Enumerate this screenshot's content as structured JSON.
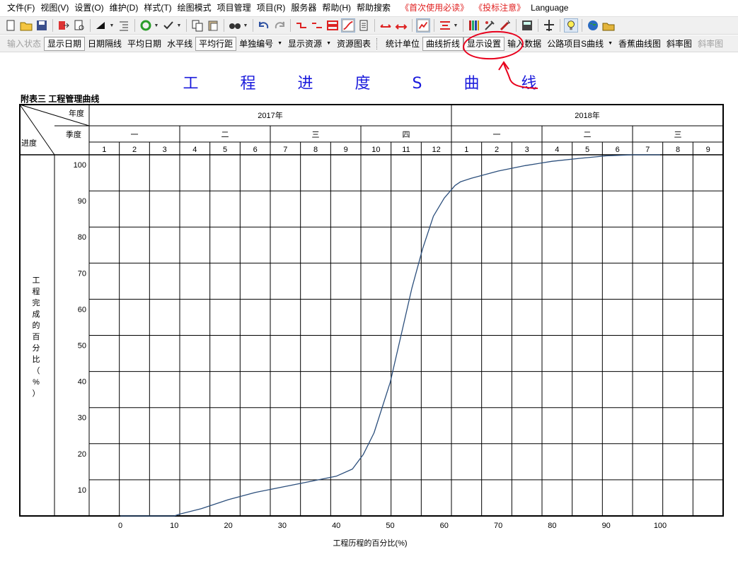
{
  "menubar": {
    "items": [
      "文件(F)",
      "视图(V)",
      "设置(O)",
      "维护(D)",
      "样式(T)",
      "绘图模式",
      "项目管理",
      "项目(R)",
      "服务器",
      "帮助(H)",
      "帮助搜索",
      "《首次使用必读》",
      "《投标注意》",
      "Language"
    ],
    "highlight_color": "#e02020"
  },
  "icon_toolbar": {
    "icons": [
      "new-icon",
      "open-icon",
      "save-icon",
      "export-icon",
      "print-preview-icon",
      "fill-icon",
      "indent-icon",
      "refresh-icon",
      "check-icon",
      "copy-icon",
      "paste-icon",
      "find-icon",
      "undo-icon",
      "redo-icon",
      "link-icon",
      "unlink-icon",
      "split-icon",
      "curve-icon",
      "resource-icon",
      "arrow-left-right-icon",
      "arrow-expand-icon",
      "chart-icon",
      "align-icon",
      "books-icon",
      "tools-icon",
      "magic-icon",
      "calculator-icon",
      "plane-icon",
      "bulb-icon",
      "globe-icon",
      "folder-icon"
    ]
  },
  "text_toolbar": {
    "buttons": [
      "输入状态",
      "显示日期",
      "日期隔线",
      "平均日期",
      "水平线",
      "平均行距",
      "单独编号",
      "显示资源",
      "资源图表",
      "统计单位",
      "曲线折线",
      "显示设置",
      "输入数据",
      "公路项目S曲线",
      "香蕉曲线图",
      "斜率图",
      "斜率图"
    ]
  },
  "document": {
    "title": "工 程 进 度 S 曲 线",
    "subtitle": "附表三    工程管理曲线",
    "title_color": "#1a1adc",
    "curve_color": "#2c4f7c"
  },
  "table": {
    "header_year_label": "年度",
    "header_quarter_label": "季度",
    "header_progress_label": "进度",
    "years": [
      "2017年",
      "2018年"
    ],
    "quarters": [
      "一",
      "二",
      "三",
      "四",
      "一",
      "二",
      "三"
    ],
    "months": [
      "1",
      "2",
      "3",
      "4",
      "5",
      "6",
      "7",
      "8",
      "9",
      "10",
      "11",
      "12",
      "1",
      "2",
      "3",
      "4",
      "5",
      "6",
      "7",
      "8",
      "9"
    ],
    "y_axis_label": "工程完成的百分比（%）",
    "x_axis_label": "工程历程的百分比(%)"
  },
  "chart_data": {
    "type": "line",
    "title": "工 程 进 度 S 曲 线",
    "xlabel": "工程历程的百分比(%)",
    "ylabel": "工程完成的百分比（%）",
    "xlim": [
      -10,
      112
    ],
    "ylim": [
      0,
      100
    ],
    "x_ticks": [
      0,
      10,
      20,
      30,
      40,
      50,
      60,
      70,
      80,
      90,
      100
    ],
    "y_ticks": [
      10,
      20,
      30,
      40,
      50,
      60,
      70,
      80,
      90,
      100
    ],
    "grid": true,
    "series": [
      {
        "x": [
          0,
          10,
          11,
          15,
          20,
          25,
          30,
          35,
          40,
          43,
          45,
          47,
          50,
          52,
          54,
          56,
          58,
          60,
          62,
          63,
          65,
          70,
          75,
          80,
          85,
          90,
          95,
          100
        ],
        "y": [
          0,
          0,
          0.5,
          2,
          4.5,
          6.5,
          8,
          9.5,
          11,
          13,
          17,
          23,
          37,
          50,
          63,
          74,
          83,
          88,
          91.5,
          92.5,
          93.5,
          95.5,
          97,
          98.2,
          99,
          99.7,
          100,
          100
        ]
      }
    ]
  },
  "annotation": {
    "color": "#e8001c"
  }
}
